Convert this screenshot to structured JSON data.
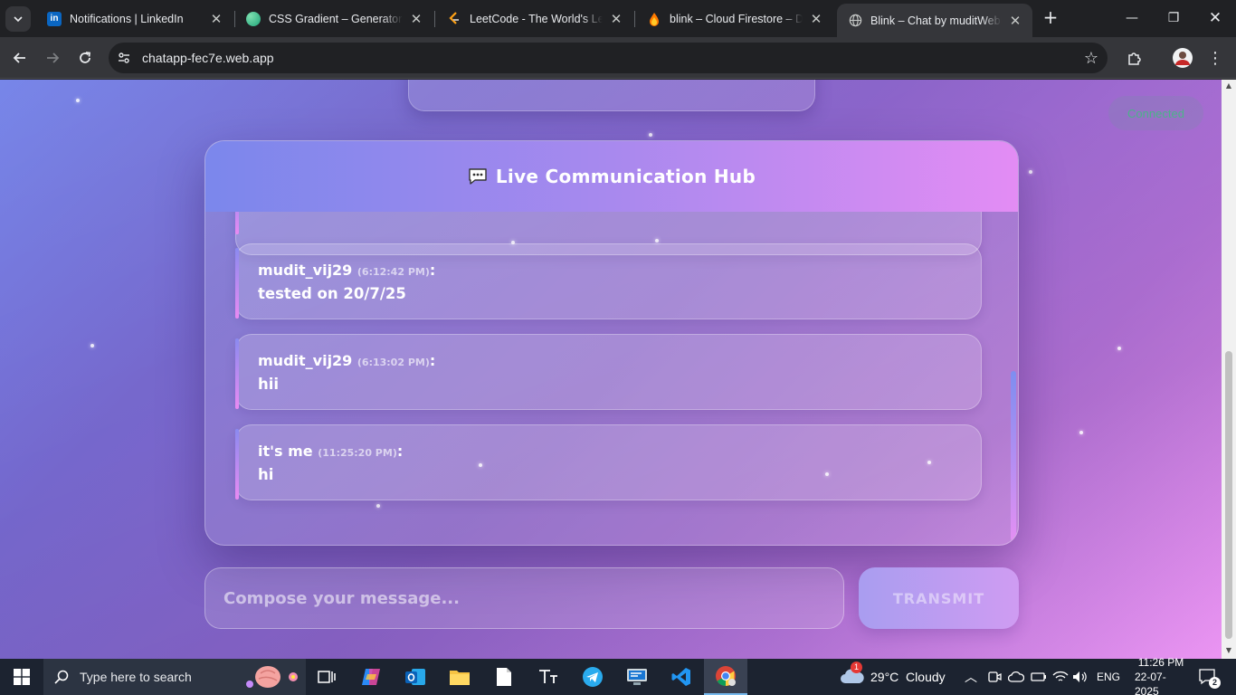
{
  "browser": {
    "tabs": [
      {
        "label": "Notifications | LinkedIn",
        "favicon": "linkedin-icon",
        "active": false
      },
      {
        "label": "CSS Gradient – Generator, Maker",
        "favicon": "cssgradient-icon",
        "active": false
      },
      {
        "label": "LeetCode - The World's Leading",
        "favicon": "leetcode-icon",
        "active": false
      },
      {
        "label": "blink – Cloud Firestore – Data",
        "favicon": "firebase-icon",
        "active": false
      },
      {
        "label": "Blink – Chat by muditWebDev",
        "favicon": "globe-icon",
        "active": true
      }
    ],
    "url": "chatapp-fec7e.web.app"
  },
  "app": {
    "status": "Connected",
    "header_title": "Live Communication Hub",
    "messages": [
      {
        "user": "mudit_vij29",
        "time": "(6:12:42 PM)",
        "text": "tested on 20/7/25"
      },
      {
        "user": "mudit_vij29",
        "time": "(6:13:02 PM)",
        "text": "hii"
      },
      {
        "user": "it's me",
        "time": "(11:25:20 PM)",
        "text": "hi"
      }
    ],
    "compose_placeholder": "Compose your message...",
    "send_label": "TRANSMIT"
  },
  "taskbar": {
    "search_placeholder": "Type here to search",
    "weather": "29°C  Cloudy",
    "weather_badge": "1",
    "language": "ENG",
    "time": "11:26 PM",
    "date": "22-07-2025",
    "notification_count": "2"
  },
  "colors": {
    "accent_gradient_start": "#7b87ec",
    "accent_gradient_end": "#e38cf4",
    "status_green": "#2ecc71"
  }
}
